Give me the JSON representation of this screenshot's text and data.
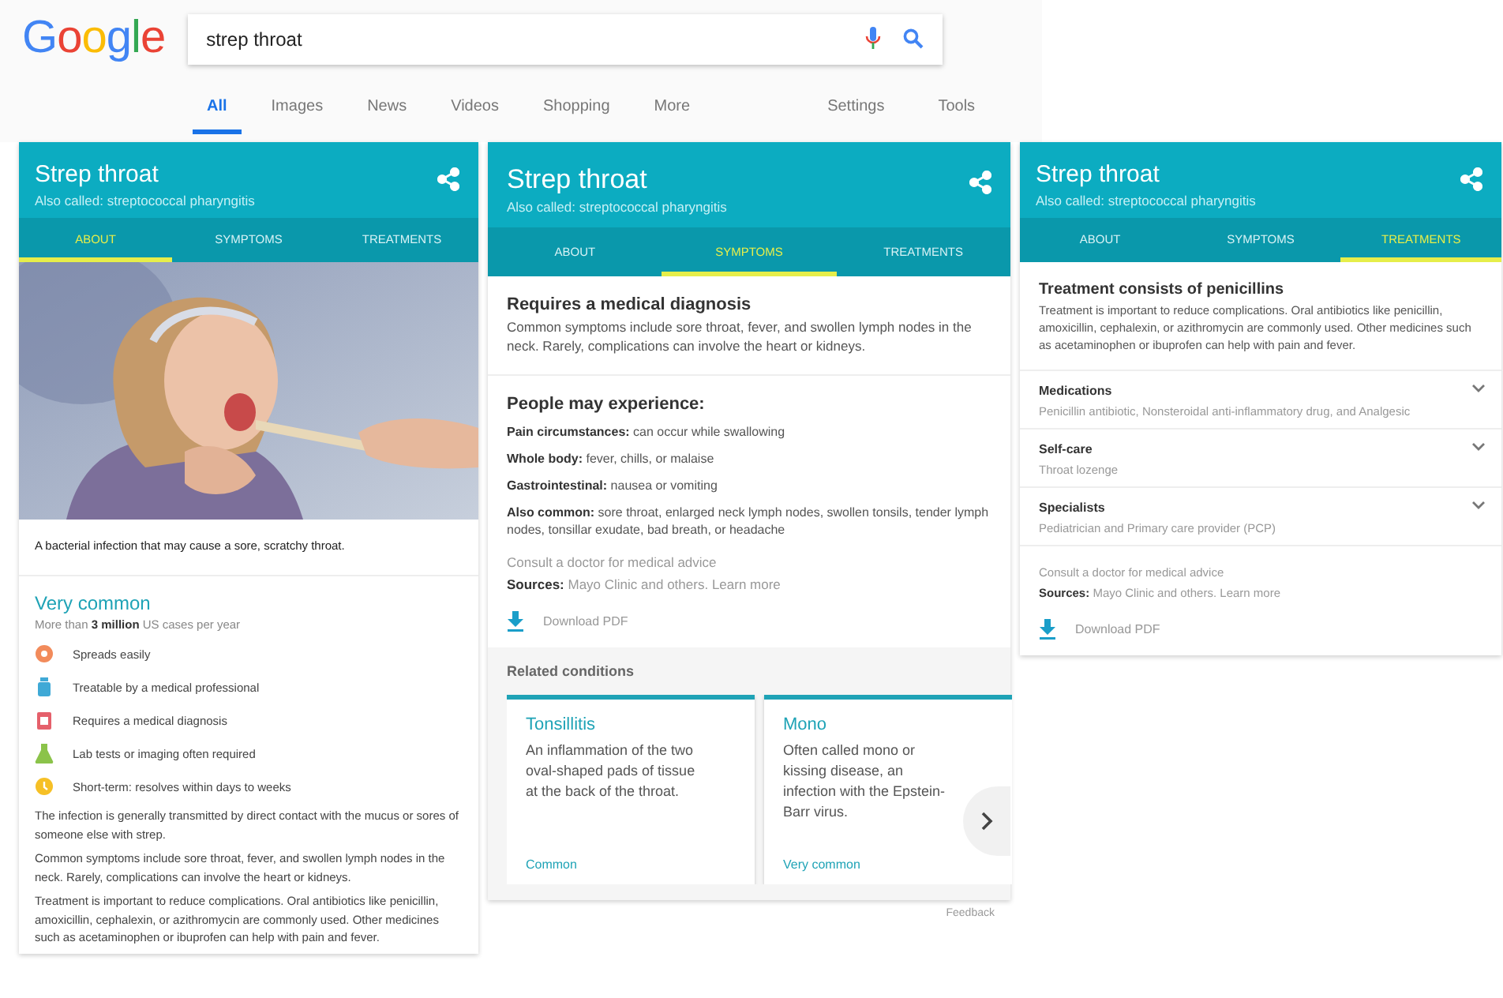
{
  "header": {
    "logo": "Google",
    "search": {
      "value": "strep throat"
    },
    "nav": [
      {
        "label": "All",
        "selected": true
      },
      {
        "label": "Images",
        "selected": false
      },
      {
        "label": "News",
        "selected": false
      },
      {
        "label": "Videos",
        "selected": false
      },
      {
        "label": "Shopping",
        "selected": false
      },
      {
        "label": "More",
        "selected": false
      }
    ],
    "tools": [
      "Settings",
      "Tools"
    ]
  },
  "about_card": {
    "title": "Strep throat",
    "subtitle": "Also called: streptococcal pharyngitis",
    "tabs": [
      {
        "label": "ABOUT",
        "selected": true
      },
      {
        "label": "SYMPTOMS",
        "selected": false
      },
      {
        "label": "TREATMENTS",
        "selected": false
      }
    ],
    "picture": {
      "kind": "picture"
    },
    "caption": "A bacterial infection that may cause a sore, scratchy throat.",
    "prevalence": {
      "heading": "Very common",
      "detail": "More than **3 million** US cases per year"
    },
    "facts": [
      {
        "kind": "virus",
        "color": "#f28b5b",
        "text": "Spreads easily"
      },
      {
        "kind": "bottle",
        "color": "#3fa9d6",
        "text": "Treatable by a medical professional"
      },
      {
        "kind": "clipboard",
        "color": "#e5606b",
        "text": "Requires a medical diagnosis"
      },
      {
        "kind": "flask",
        "color": "#8bc34a",
        "text": "Lab tests or imaging often required"
      },
      {
        "kind": "clock",
        "color": "#f6c026",
        "text": "Short-term: resolves within days to weeks"
      }
    ],
    "paragraphs": [
      "The infection is generally transmitted by direct contact with the mucus or sores of someone else with strep.",
      "Common symptoms include sore throat, fever, and swollen lymph nodes in the neck. Rarely, complications can involve the heart or kidneys.",
      "Treatment is important to reduce complications. Oral antibiotics like penicillin, amoxicillin, cephalexin, or azithromycin are commonly used. Other medicines such as acetaminophen or ibuprofen can help with pain and fever."
    ]
  },
  "symptoms_card": {
    "title": "Strep throat",
    "subtitle": "Also called: streptococcal pharyngitis",
    "tabs": [
      {
        "label": "ABOUT",
        "selected": false
      },
      {
        "label": "SYMPTOMS",
        "selected": true
      },
      {
        "label": "TREATMENTS",
        "selected": false
      }
    ],
    "diagnosis": {
      "heading": "Requires a medical diagnosis",
      "text": "Common symptoms include sore throat, fever, and swollen lymph nodes in the neck. Rarely, complications can involve the heart or kidneys."
    },
    "experience": {
      "heading": "People may experience:",
      "items": [
        "**Pain circumstances:** can occur while swallowing",
        "**Whole body:** fever, chills, or malaise",
        "**Gastrointestinal:** nausea or vomiting",
        "**Also common:** sore throat, enlarged neck lymph nodes, swollen tonsils, tender lymph nodes, tonsillar exudate, bad breath, or headache"
      ]
    },
    "advice": "Consult a doctor for medical advice",
    "sources": {
      "text": "**Sources:** Mayo Clinic and others.",
      "link": "Learn more"
    },
    "download": "Download PDF",
    "related": {
      "heading": "Related conditions",
      "items": [
        {
          "title": "Tonsillitis",
          "text": "An inflammation of the two oval-shaped pads of tissue at the back of the throat.",
          "frequency": "Common"
        },
        {
          "title": "Mono",
          "text": "Often called mono or kissing disease, an infection with the Epstein-Barr virus.",
          "frequency": "Very common"
        }
      ]
    },
    "feedback": "Feedback"
  },
  "treatments_card": {
    "title": "Strep throat",
    "subtitle": "Also called: streptococcal pharyngitis",
    "tabs": [
      {
        "label": "ABOUT",
        "selected": false
      },
      {
        "label": "SYMPTOMS",
        "selected": false
      },
      {
        "label": "TREATMENTS",
        "selected": true
      }
    ],
    "summary": {
      "heading": "Treatment consists of penicillins",
      "text": "Treatment is important to reduce complications. Oral antibiotics like penicillin, amoxicillin, cephalexin, or azithromycin are commonly used. Other medicines such as acetaminophen or ibuprofen can help with pain and fever."
    },
    "sections": [
      {
        "title": "Medications",
        "text": "Penicillin antibiotic, Nonsteroidal anti-inflammatory drug, and Analgesic",
        "expanded": false
      },
      {
        "title": "Self-care",
        "text": "Throat lozenge",
        "expanded": false
      },
      {
        "title": "Specialists",
        "text": "Pediatrician and Primary care provider (PCP)",
        "expanded": false
      }
    ],
    "advice": "Consult a doctor for medical advice",
    "sources": {
      "text": "**Sources:** Mayo Clinic and others.",
      "link": "Learn more"
    },
    "download": "Download PDF"
  }
}
